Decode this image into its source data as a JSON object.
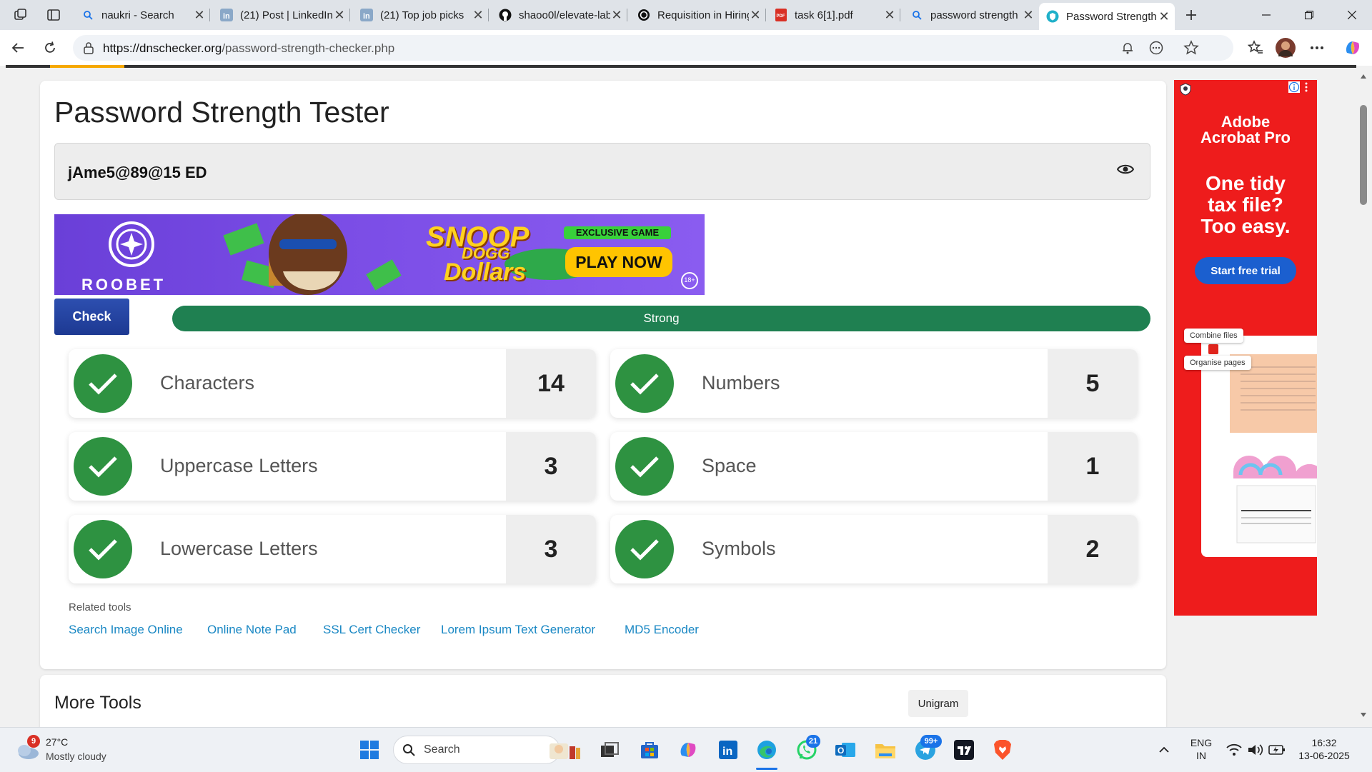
{
  "browser": {
    "tabs": [
      {
        "title": "naukri - Search",
        "icon": "search-icon"
      },
      {
        "title": "(21) Post | LinkedIn",
        "icon": "linkedin-icon"
      },
      {
        "title": "(21) Top job picks",
        "icon": "linkedin-icon"
      },
      {
        "title": "shaoo0l/elevate-lab",
        "icon": "github-icon"
      },
      {
        "title": "Requisition in Hiring",
        "icon": "openai-icon"
      },
      {
        "title": "task 6[1].pdf",
        "icon": "pdf-icon"
      },
      {
        "title": "password strength",
        "icon": "search-icon"
      },
      {
        "title": "Password Strength",
        "icon": "shield-icon",
        "active": true
      }
    ],
    "url_host": "https://dnschecker.org",
    "url_path": "/password-strength-checker.php"
  },
  "page": {
    "title": "Password Strength Tester",
    "password_value": "jAme5@89@15 ED",
    "check_label": "Check",
    "strength_label": "Strong",
    "strength_color": "#1f8051",
    "metrics": [
      {
        "label": "Characters",
        "value": "14"
      },
      {
        "label": "Numbers",
        "value": "5"
      },
      {
        "label": "Uppercase Letters",
        "value": "3"
      },
      {
        "label": "Space",
        "value": "1"
      },
      {
        "label": "Lowercase Letters",
        "value": "3"
      },
      {
        "label": "Symbols",
        "value": "2"
      }
    ],
    "related_title": "Related tools",
    "related_links": [
      "Search Image Online",
      "Online Note Pad",
      "SSL Cert Checker",
      "Lorem Ipsum Text Generator",
      "MD5 Encoder"
    ],
    "more_tools_title": "More Tools",
    "unigram_label": "Unigram"
  },
  "banner_ad": {
    "brand": "ROOBET",
    "game_title_line1": "SNOOP",
    "game_title_line2": "DOGG",
    "game_title_line3": "Dollars",
    "tag": "EXCLUSIVE GAME",
    "cta": "PLAY NOW",
    "age": "18+"
  },
  "side_ad": {
    "brand_line1": "Adobe",
    "brand_line2": "Acrobat Pro",
    "headline_line1": "One tidy",
    "headline_line2": "tax file?",
    "headline_line3": "Too easy.",
    "cta": "Start free trial",
    "pill1": "Combine files",
    "pill2": "Organise pages"
  },
  "taskbar": {
    "weather_temp": "27°C",
    "weather_desc": "Mostly cloudy",
    "weather_badge": "9",
    "search_placeholder": "Search",
    "whatsapp_badge": "21",
    "telegram_badge": "99+",
    "lang_line1": "ENG",
    "lang_line2": "IN",
    "time": "16:32",
    "date": "13-06-2025"
  }
}
